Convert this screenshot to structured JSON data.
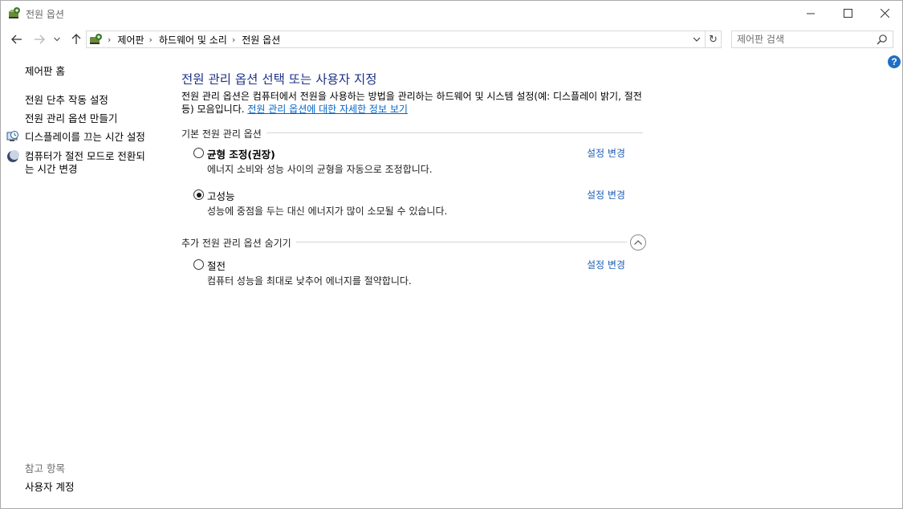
{
  "window": {
    "title": "전원 옵션",
    "controls": {
      "minimize": "—",
      "maximize": "☐",
      "close": "✕"
    }
  },
  "nav": {
    "breadcrumbs": [
      "제어판",
      "하드웨어 및 소리",
      "전원 옵션"
    ],
    "search_placeholder": "제어판 검색",
    "help": "?"
  },
  "sidebar": {
    "home": "제어판 홈",
    "links": [
      "전원 단추 작동 설정",
      "전원 관리 옵션 만들기",
      "디스플레이를 끄는 시간 설정",
      "컴퓨터가 절전 모드로 전환되는 시간 변경"
    ],
    "sleep_line1": "컴퓨터가 절전 모드로 전환되",
    "sleep_line2": "는 시간 변경",
    "see_also_header": "참고 항목",
    "see_also_link": "사용자 계정"
  },
  "main": {
    "title": "전원 관리 옵션 선택 또는 사용자 지정",
    "description": "전원 관리 옵션은 컴퓨터에서 전원을 사용하는 방법을 관리하는 하드웨어 및 시스템 설정(예: 디스플레이 밝기, 절전 등) 모음입니다. ",
    "description_link": "전원 관리 옵션에 대한 자세한 정보 보기",
    "preferred_header": "기본 전원 관리 옵션",
    "hide_header": "추가 전원 관리 옵션 숨기기",
    "plans": [
      {
        "name": "균형 조정(권장)",
        "desc": "에너지 소비와 성능 사이의 균형을 자동으로 조정합니다.",
        "link": "설정 변경",
        "selected": false
      },
      {
        "name": "고성능",
        "desc": "성능에 중점을 두는 대신 에너지가 많이 소모될 수 있습니다.",
        "link": "설정 변경",
        "selected": true
      },
      {
        "name": "절전",
        "desc": "컴퓨터 성능을 최대로 낮추어 에너지를 절약합니다.",
        "link": "설정 변경",
        "selected": false
      }
    ]
  }
}
